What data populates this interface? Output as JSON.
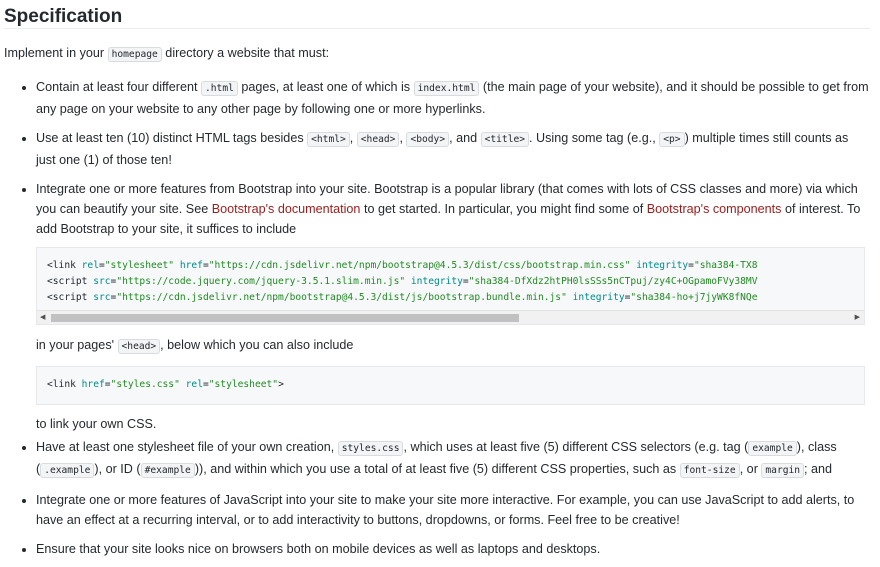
{
  "title": "Specification",
  "intro": {
    "pre": "Implement in your ",
    "code": "homepage",
    "post": " directory a website that must:"
  },
  "items": {
    "one": {
      "a": "Contain at least four different ",
      "c1": ".html",
      "b": " pages, at least one of which is ",
      "c2": "index.html",
      "d": " (the main page of your website), and it should be possible to get from any page on your website to any other page by following one or more hyperlinks."
    },
    "two": {
      "a": "Use at least ten (10) distinct HTML tags besides ",
      "c1": "<html>",
      "s1": ", ",
      "c2": "<head>",
      "s2": ", ",
      "c3": "<body>",
      "s3": ", and ",
      "c4": "<title>",
      "b": ". Using some tag (e.g., ",
      "c5": "<p>",
      "d": ") multiple times still counts as just one (1) of those ten!"
    },
    "three": {
      "a": "Integrate one or more features from Bootstrap into your site. Bootstrap is a popular library (that comes with lots of CSS classes and more) via which you can beautify your site. See ",
      "link1": "Bootstrap's documentation",
      "b": " to get started. In particular, you might find some of ",
      "link2": "Bootstrap's components",
      "c": " of interest. To add Bootstrap to your site, it suffices to include",
      "code_lines": [
        {
          "t1": "<link ",
          "a1": "rel",
          "e1": "=",
          "v1": "\"stylesheet\"",
          "sp": " ",
          "a2": "href",
          "e2": "=",
          "v2": "\"https://cdn.jsdelivr.net/npm/bootstrap@4.5.3/dist/css/bootstrap.min.css\"",
          "sp2": " ",
          "a3": "integrity",
          "e3": "=",
          "v3": "\"sha384-TX8"
        },
        {
          "t1": "<script ",
          "a1": "src",
          "e1": "=",
          "v1": "\"https://code.jquery.com/jquery-3.5.1.slim.min.js\"",
          "sp": " ",
          "a2": "integrity",
          "e2": "=",
          "v2": "\"sha384-DfXdz2htPH0lsSSs5nCTpuj/zy4C+OGpamoFVy38MV"
        },
        {
          "t1": "<script ",
          "a1": "src",
          "e1": "=",
          "v1": "\"https://cdn.jsdelivr.net/npm/bootstrap@4.5.3/dist/js/bootstrap.bundle.min.js\"",
          "sp": " ",
          "a2": "integrity",
          "e2": "=",
          "v2": "\"sha384-ho+j7jyWK8fNQe"
        }
      ],
      "scroll_left": "◀",
      "scroll_right": "▶",
      "in_pages_a": "in your pages' ",
      "in_pages_code": "<head>",
      "in_pages_b": ", below which you can also include",
      "code2": {
        "t1": "<link ",
        "a1": "href",
        "e1": "=",
        "v1": "\"styles.css\"",
        "sp": " ",
        "a2": "rel",
        "e2": "=",
        "v2": "\"stylesheet\"",
        "t2": ">"
      },
      "after": "to link your own CSS."
    },
    "four": {
      "a": "Have at least one stylesheet file of your own creation, ",
      "c1": "styles.css",
      "b": ", which uses at least five (5) different CSS selectors (e.g. tag (",
      "c2": "example",
      "c": "), class (",
      "c3": ".example",
      "d": "), or ID (",
      "c4": "#example",
      "e": ")), and within which you use a total of at least five (5) different CSS properties, such as ",
      "c5": "font-size",
      "f": ", or ",
      "c6": "margin",
      "g": "; and"
    },
    "five": {
      "a": "Integrate one or more features of JavaScript into your site to make your site more interactive. For example, you can use JavaScript to add alerts, to have an effect at a recurring interval, or to add interactivity to buttons, dropdowns, or forms. Feel free to be creative!"
    },
    "six": {
      "a": "Ensure that your site looks nice on browsers both on mobile devices as well as laptops and desktops."
    }
  }
}
